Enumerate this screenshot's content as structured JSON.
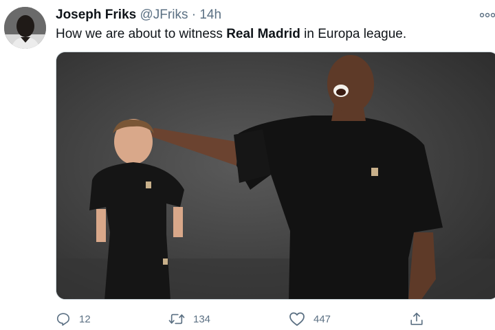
{
  "tweet": {
    "author_name": "Joseph Friks",
    "author_handle": "@JFriks",
    "separator": "·",
    "time": "14h",
    "text_before": "How we are about to witness ",
    "text_bold": "Real Madrid",
    "text_after": " in Europa league.",
    "media_alt": "Photo of a tall laughing man in black resting his hand on the head of a much smaller man also dressed in black"
  },
  "actions": {
    "reply_count": "12",
    "retweet_count": "134",
    "like_count": "447"
  },
  "icons": {
    "reply": "reply-icon",
    "retweet": "retweet-icon",
    "like": "heart-icon",
    "share": "share-icon",
    "more": "more-options-icon"
  },
  "colors": {
    "text": "#0f1419",
    "muted": "#5b7083",
    "border": "#cfd9de"
  }
}
